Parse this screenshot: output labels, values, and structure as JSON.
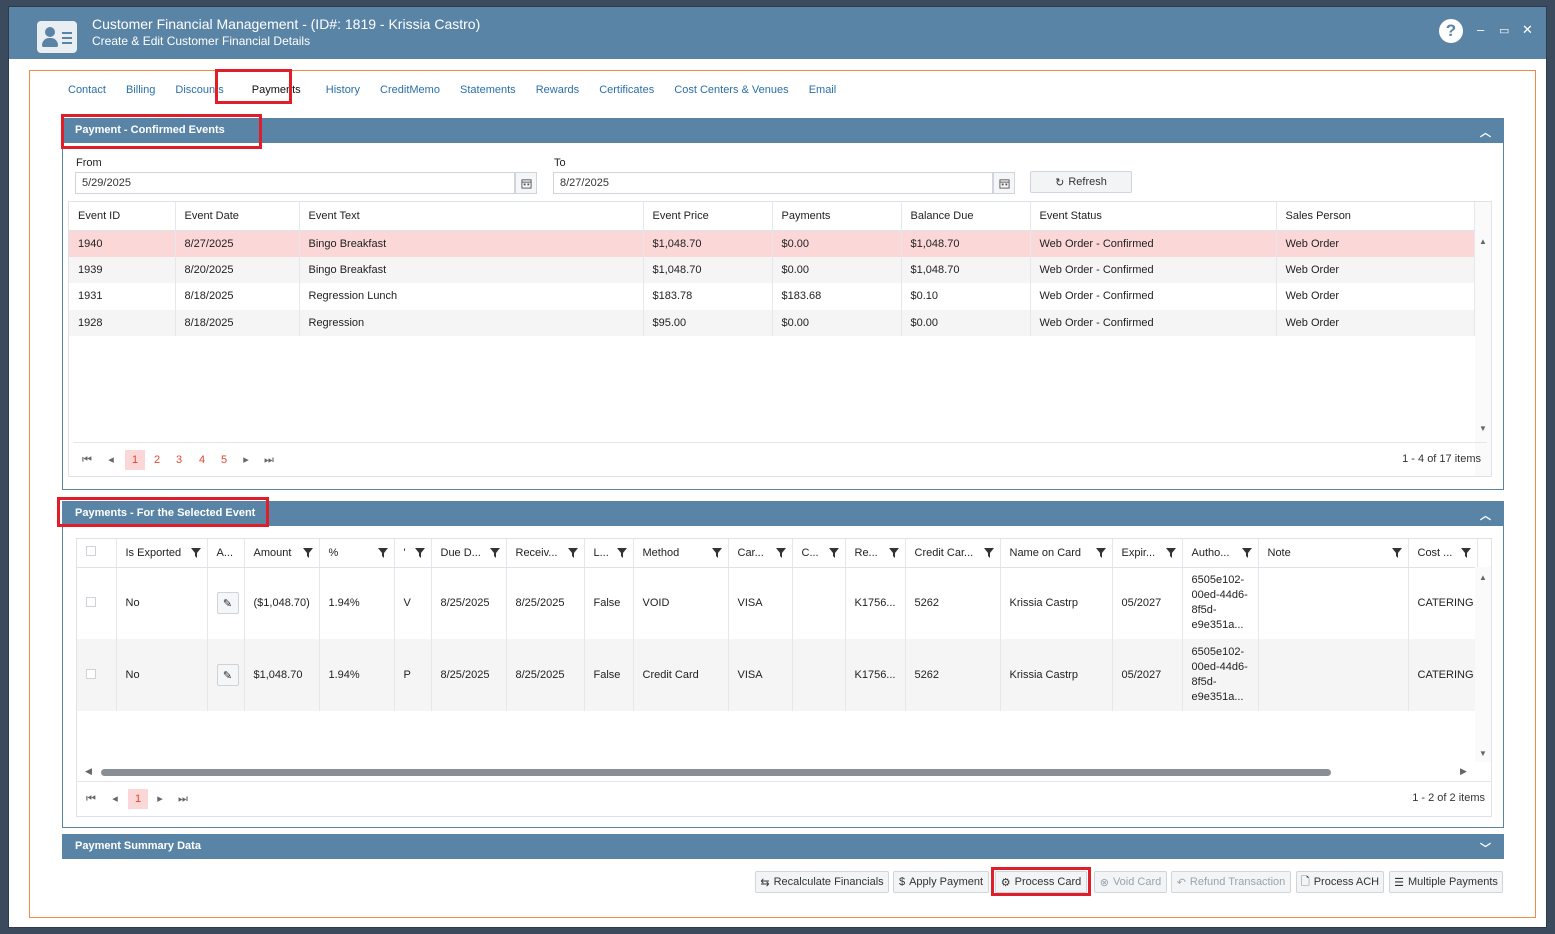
{
  "window": {
    "title": "Customer Financial Management - (ID#: 1819 - Krissia Castro)",
    "subtitle": "Create & Edit Customer Financial Details",
    "help": "?",
    "minimize": "–",
    "maximize": "▭",
    "close": "✕"
  },
  "tabs": [
    "Contact",
    "Billing",
    "Discounts",
    "Payments",
    "History",
    "CreditMemo",
    "Statements",
    "Rewards",
    "Certificates",
    "Cost Centers & Venues",
    "Email"
  ],
  "confirmed_events": {
    "title": "Payment - Confirmed Events",
    "from_label": "From",
    "from_value": "5/29/2025",
    "to_label": "To",
    "to_value": "8/27/2025",
    "refresh_label": "Refresh",
    "columns": [
      "Event ID",
      "Event Date",
      "Event Text",
      "Event Price",
      "Payments",
      "Balance Due",
      "Event Status",
      "Sales Person"
    ],
    "rows": [
      [
        "1940",
        "8/27/2025",
        "Bingo Breakfast",
        "$1,048.70",
        "$0.00",
        "$1,048.70",
        "Web Order - Confirmed",
        "Web Order"
      ],
      [
        "1939",
        "8/20/2025",
        "Bingo Breakfast",
        "$1,048.70",
        "$0.00",
        "$1,048.70",
        "Web Order - Confirmed",
        "Web Order"
      ],
      [
        "1931",
        "8/18/2025",
        "Regression Lunch",
        "$183.78",
        "$183.68",
        "$0.10",
        "Web Order - Confirmed",
        "Web Order"
      ],
      [
        "1928",
        "8/18/2025",
        "Regression",
        "$95.00",
        "$0.00",
        "$0.00",
        "Web Order - Confirmed",
        "Web Order"
      ]
    ],
    "pages": [
      "1",
      "2",
      "3",
      "4",
      "5"
    ],
    "pager_info": "1 - 4 of 17 items"
  },
  "selected_payments": {
    "title": "Payments - For the Selected Event",
    "columns": [
      "",
      "Is Exported",
      "A...",
      "Amount",
      "%",
      "'",
      "Due D...",
      "Receiv...",
      "L...",
      "Method",
      "Car...",
      "C...",
      "Re...",
      "Credit Car...",
      "Name on Card",
      "Expir...",
      "Autho...",
      "Note",
      "Cost ..."
    ],
    "rows": [
      [
        "",
        "No",
        "",
        "($1,048.70)",
        "1.94%",
        "V",
        "8/25/2025",
        "8/25/2025",
        "False",
        "VOID",
        "VISA",
        "",
        "K1756...",
        "5262",
        "Krissia Castrp",
        "05/2027",
        "6505e102-00ed-44d6-8f5d-e9e351a...",
        "",
        "CATERING"
      ],
      [
        "",
        "No",
        "",
        "$1,048.70",
        "1.94%",
        "P",
        "8/25/2025",
        "8/25/2025",
        "False",
        "Credit Card",
        "VISA",
        "",
        "K1756...",
        "5262",
        "Krissia Castrp",
        "05/2027",
        "6505e102-00ed-44d6-8f5d-e9e351a...",
        "",
        "CATERING"
      ]
    ],
    "pages": [
      "1"
    ],
    "pager_info": "1 - 2 of 2 items"
  },
  "summary": {
    "title": "Payment Summary Data"
  },
  "actions": {
    "recalculate": "Recalculate Financials",
    "apply_payment": "Apply Payment",
    "process_card": "Process Card",
    "void_card": "Void Card",
    "refund": "Refund Transaction",
    "process_ach": "Process ACH",
    "multiple_payments": "Multiple Payments"
  },
  "accent_colors": {
    "header": "#5a84a6",
    "selected_row": "#fbd7d7",
    "highlight_box": "#e11d2a",
    "frame": "#f08a4b"
  }
}
